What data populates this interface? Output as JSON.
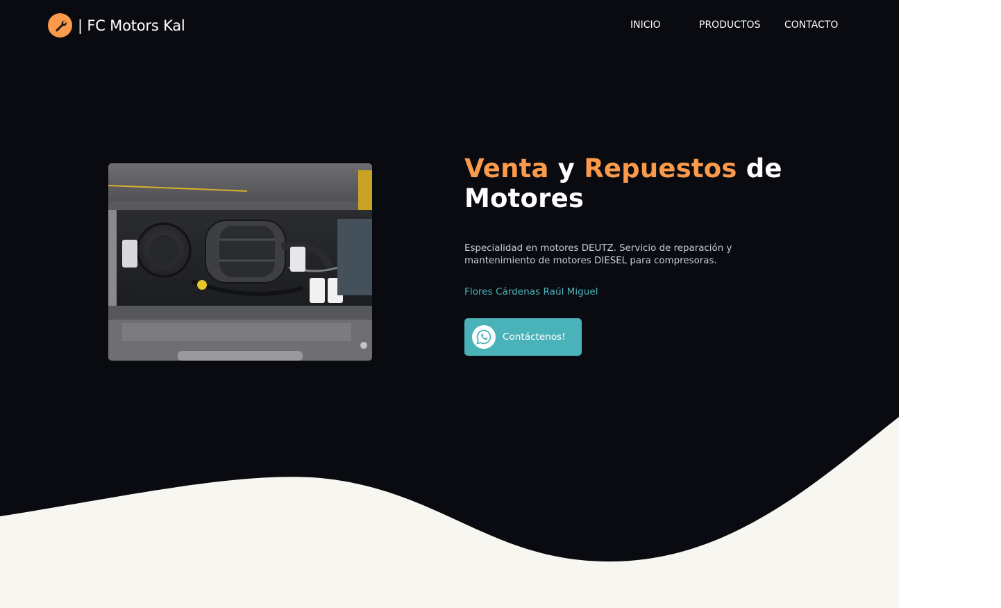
{
  "header": {
    "brand": "| FC Motors Kal",
    "logo_icon": "wrench-icon",
    "nav": [
      {
        "label": "INICIO"
      },
      {
        "label": "PRODUCTOS"
      },
      {
        "label": "CONTACTO"
      }
    ]
  },
  "hero": {
    "headline": {
      "part1": "Venta",
      "part2": " y ",
      "part3": "Repuestos",
      "part4": " de Motores"
    },
    "description": "Especialidad en motores DEUTZ. Servicio de reparación y mantenimiento de motores DIESEL para compresoras.",
    "owner": "Flores Cárdenas Raúl Miguel",
    "cta_label": "Contáctenos!",
    "cta_icon": "whatsapp-icon"
  },
  "colors": {
    "background": "#090b10",
    "accent_orange": "#fb9a4b",
    "accent_teal": "#4ab3ba",
    "wave_cream": "#f8f6f1"
  }
}
